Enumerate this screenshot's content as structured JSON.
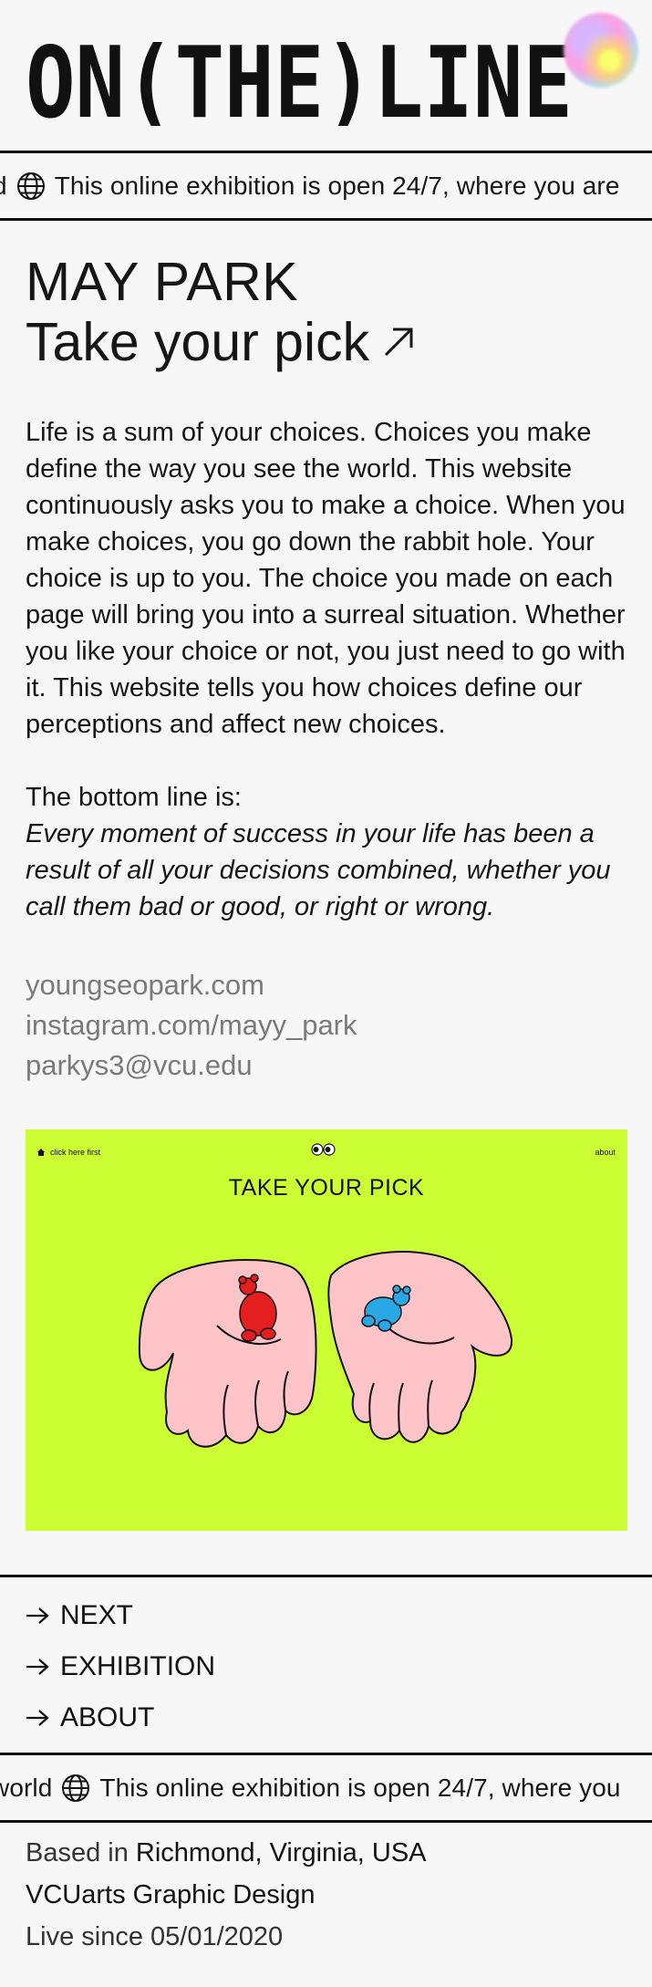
{
  "header": {
    "logo_text": "ON(THE)LINE"
  },
  "ticker_top": {
    "pre": "d",
    "text": "This online exhibition is open 24/7, where you are"
  },
  "project": {
    "artist": "MAY PARK",
    "title": "Take your pick",
    "description": "Life is a sum of your choices. Choices you make define the way you see the world. This website continuously asks you to make a choice. When you make choices, you go down the rabbit hole. Your choice is up to you. The choice you made on each page will bring you into a surreal situation. Whether you like your choice or not, you just need to go with it. This website tells you how choices define our perceptions and affect new choices.",
    "bottom_line_label": "The bottom line is:",
    "bottom_line_quote": "Every moment of success in your life has been a result of all your decisions combined, whether you call them bad or good, or right or wrong.",
    "links": {
      "website": "youngseopark.com",
      "instagram": "instagram.com/mayy_park",
      "email": "parkys3@vcu.edu"
    }
  },
  "preview": {
    "background_color": "#ccff33",
    "click_label": "click here first",
    "about_label": "about",
    "title": "TAKE YOUR PICK"
  },
  "nav": {
    "next": "NEXT",
    "exhibition": "EXHIBITION",
    "about": "ABOUT"
  },
  "ticker_bottom": {
    "pre": "world",
    "text": "This online exhibition is open 24/7, where you"
  },
  "footer": {
    "based_prefix": "Based in",
    "location": "Richmond, Virginia, USA",
    "school": "VCUarts Graphic Design",
    "live_since": "Live since 05/01/2020"
  },
  "icons": [
    "globe-icon",
    "arrow-up-right-icon",
    "arrow-right-icon",
    "home-icon",
    "eyes-icon"
  ]
}
